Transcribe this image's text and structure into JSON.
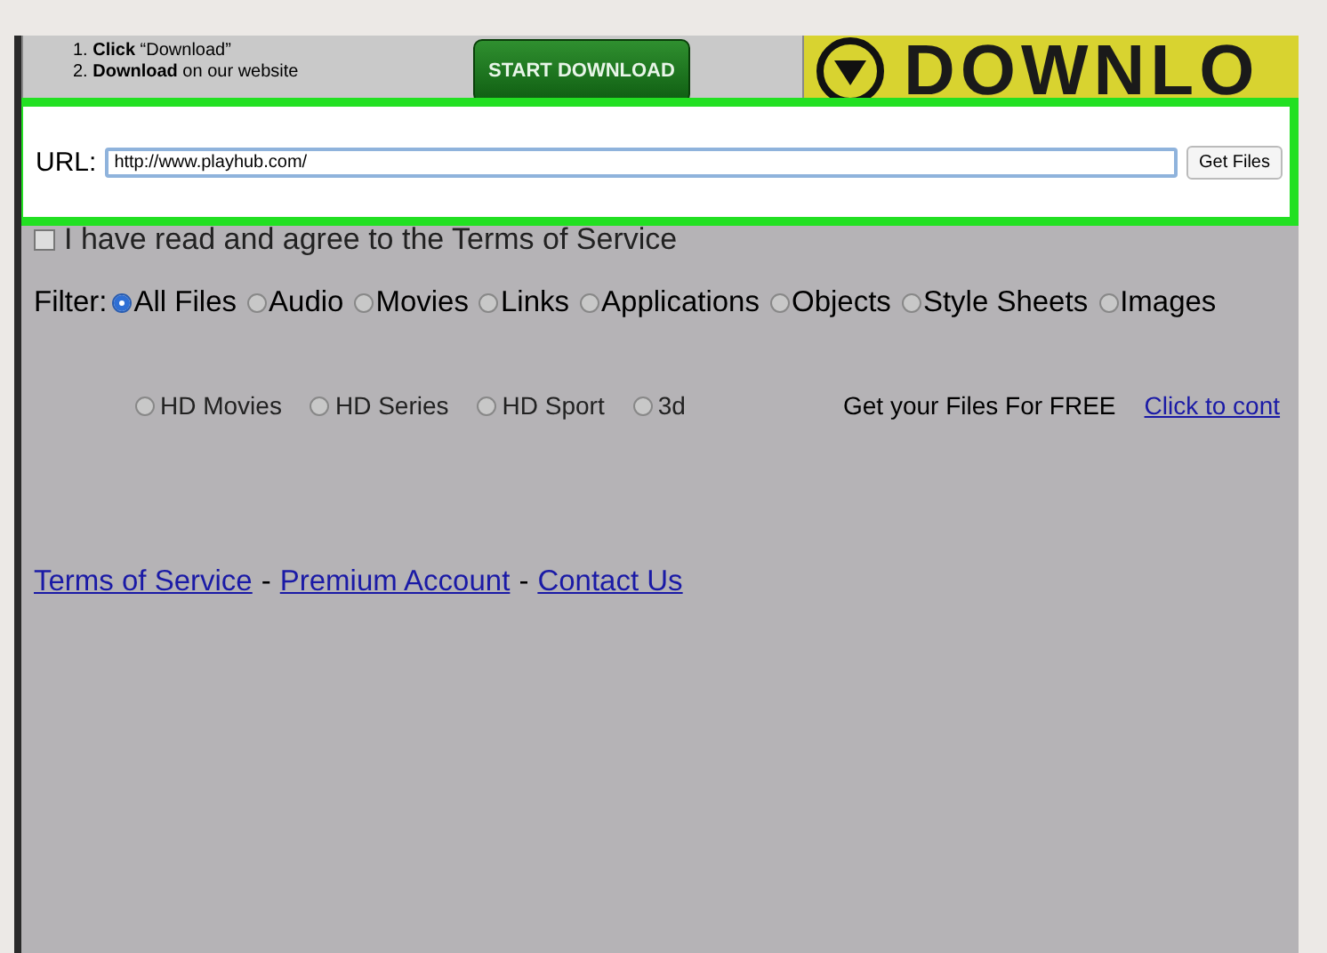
{
  "banner": {
    "steps": [
      "1. **Click** “Download”",
      "2. **Download** on our website"
    ],
    "button": "START DOWNLOAD",
    "ad_text": "DOWNLO"
  },
  "url_form": {
    "label": "URL:",
    "value": "http://www.playhub.com/",
    "button": "Get Files"
  },
  "terms": {
    "label": "I have read and agree to the Terms of Service",
    "checked": false
  },
  "filter": {
    "label": "Filter:",
    "options": [
      {
        "label": "All Files",
        "selected": true
      },
      {
        "label": "Audio",
        "selected": false
      },
      {
        "label": "Movies",
        "selected": false
      },
      {
        "label": "Links",
        "selected": false
      },
      {
        "label": "Applications",
        "selected": false
      },
      {
        "label": "Objects",
        "selected": false
      },
      {
        "label": "Style Sheets",
        "selected": false
      },
      {
        "label": "Images",
        "selected": false
      }
    ]
  },
  "categories": [
    {
      "label": "HD Movies",
      "selected": false
    },
    {
      "label": "HD Series",
      "selected": false
    },
    {
      "label": "HD Sport",
      "selected": false
    },
    {
      "label": "3d",
      "selected": false
    }
  ],
  "promo": {
    "text": "Get your Files For FREE",
    "link": "Click to cont"
  },
  "footer_links": [
    "Terms of Service",
    "Premium Account",
    "Contact Us"
  ],
  "footer_separator": "-"
}
